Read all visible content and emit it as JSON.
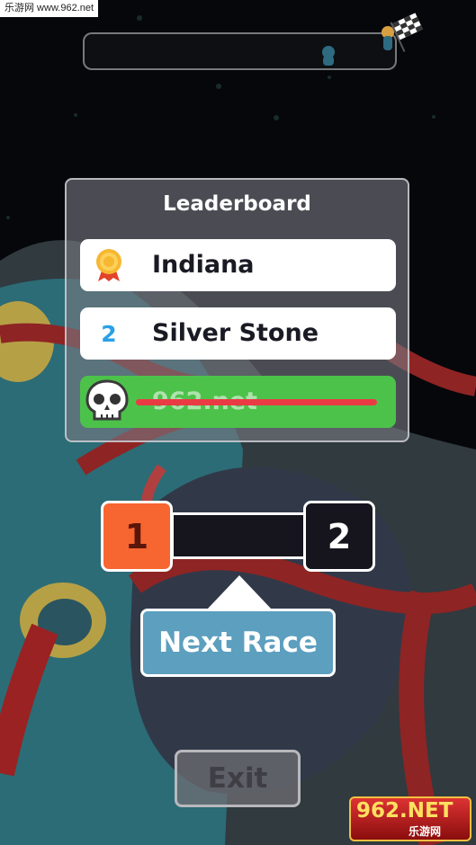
{
  "watermark_top": "乐游网 www.962.net",
  "leaderboard": {
    "title": "Leaderboard",
    "rows": [
      {
        "rank_icon": "medal-icon",
        "name": "Indiana"
      },
      {
        "rank": "2",
        "name": "Silver Stone"
      },
      {
        "rank_icon": "skull-icon",
        "name": "962.net",
        "eliminated": true
      }
    ]
  },
  "score": {
    "left": "1",
    "right": "2",
    "left_color": "#f76530",
    "right_color": "#16151e"
  },
  "buttons": {
    "next_race": "Next Race",
    "exit": "Exit"
  },
  "watermark_logo": {
    "main": "962.NET",
    "sub": "乐游网"
  },
  "colors": {
    "panel_green": "#4dc24a",
    "strike_red": "#ea3b44",
    "button_blue": "#5c9fbe"
  }
}
